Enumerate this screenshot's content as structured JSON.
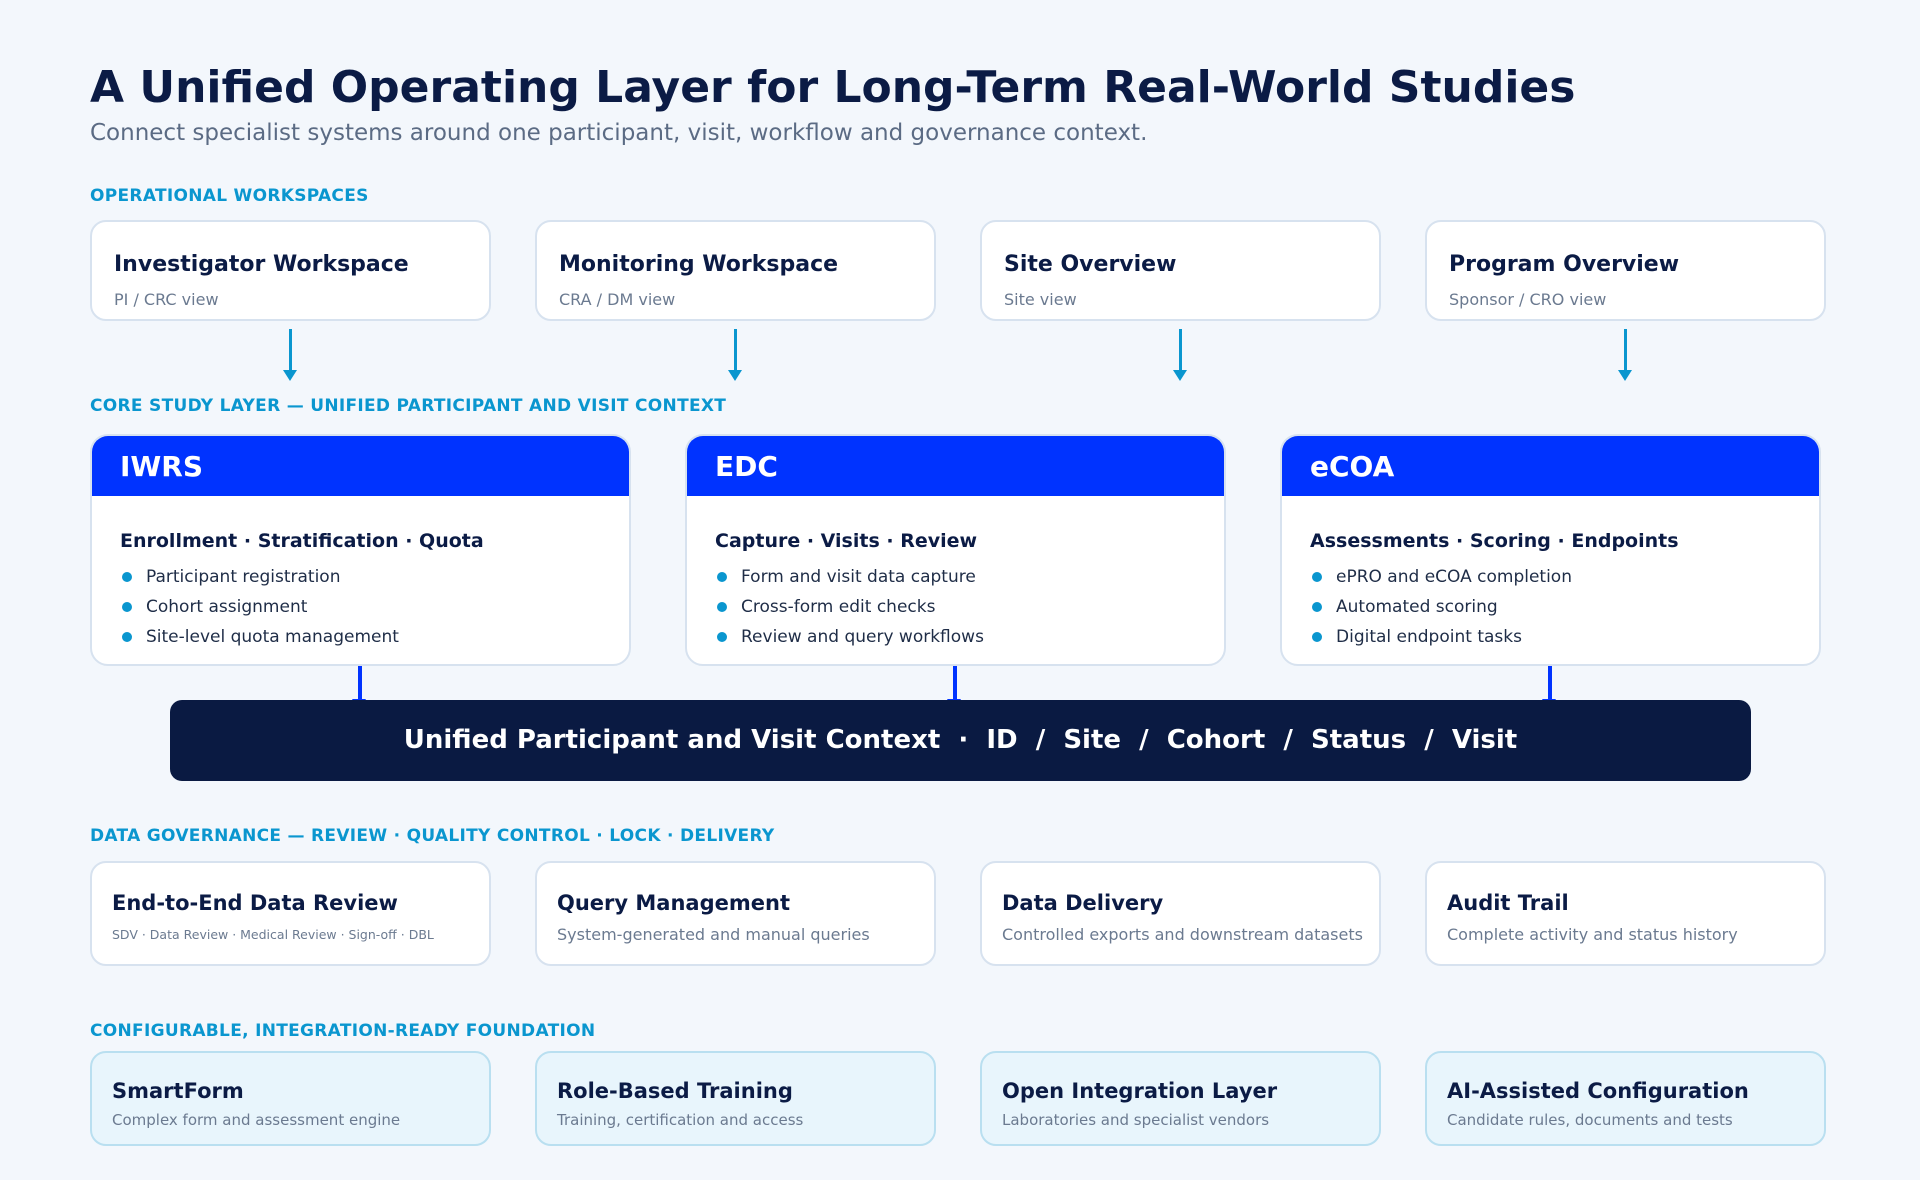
{
  "header": {
    "title": "A Unified Operating Layer for Long-Term Real-World Studies",
    "subtitle": "Connect specialist systems around one participant, visit, workflow and governance context."
  },
  "workspaces": {
    "label": "OPERATIONAL WORKSPACES",
    "items": [
      {
        "title": "Investigator Workspace",
        "sub": "PI / CRC view"
      },
      {
        "title": "Monitoring Workspace",
        "sub": "CRA / DM view"
      },
      {
        "title": "Site Overview",
        "sub": "Site view"
      },
      {
        "title": "Program Overview",
        "sub": "Sponsor / CRO view"
      }
    ]
  },
  "core": {
    "label": "CORE STUDY LAYER — UNIFIED PARTICIPANT AND VISIT CONTEXT",
    "items": [
      {
        "name": "IWRS",
        "heading": "Enrollment · Stratification · Quota",
        "bullets": [
          "Participant registration",
          "Cohort assignment",
          "Site-level quota management"
        ]
      },
      {
        "name": "EDC",
        "heading": "Capture · Visits · Review",
        "bullets": [
          "Form and visit data capture",
          "Cross-form edit checks",
          "Review and query workflows"
        ]
      },
      {
        "name": "eCOA",
        "heading": "Assessments · Scoring · Endpoints",
        "bullets": [
          "ePRO and eCOA completion",
          "Automated scoring",
          "Digital endpoint tasks"
        ]
      }
    ]
  },
  "context_bar": {
    "text": "Unified Participant and Visit Context  ·  ID  /  Site  /  Cohort  /  Status  /  Visit"
  },
  "governance": {
    "label": "DATA GOVERNANCE — REVIEW · QUALITY CONTROL · LOCK · DELIVERY",
    "items": [
      {
        "title": "End-to-End Data Review",
        "sub": "SDV · Data Review · Medical Review · Sign-off · DBL"
      },
      {
        "title": "Query Management",
        "sub": "System-generated and manual queries"
      },
      {
        "title": "Data Delivery",
        "sub": "Controlled exports and downstream datasets"
      },
      {
        "title": "Audit Trail",
        "sub": "Complete activity and status history"
      }
    ]
  },
  "foundation": {
    "label": "CONFIGURABLE, INTEGRATION-READY FOUNDATION",
    "items": [
      {
        "title": "SmartForm",
        "sub": "Complex form and assessment engine"
      },
      {
        "title": "Role-Based Training",
        "sub": "Training, certification and access"
      },
      {
        "title": "Open Integration Layer",
        "sub": "Laboratories and specialist vendors"
      },
      {
        "title": "AI-Assisted Configuration",
        "sub": "Candidate rules, documents and tests"
      }
    ]
  },
  "colors": {
    "accent_blue": "#0033ff",
    "section_cyan": "#0a96cf",
    "navy": "#0a1a42",
    "foundation_bg": "#e8f5fc"
  }
}
